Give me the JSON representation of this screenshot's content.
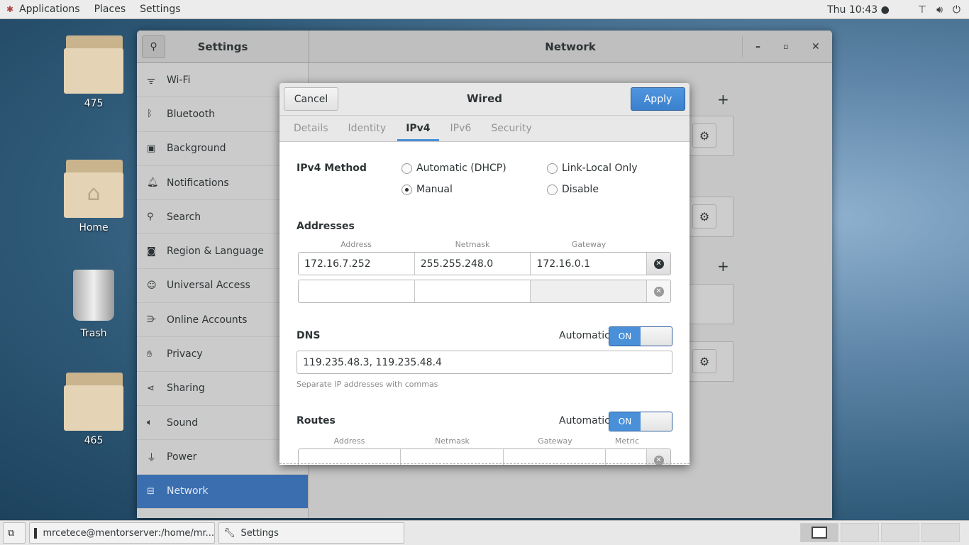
{
  "topbar": {
    "applications": "Applications",
    "places": "Places",
    "settings": "Settings",
    "clock": "Thu 10:43",
    "icons": [
      "network-icon",
      "volume-icon",
      "power-icon"
    ]
  },
  "desktop": [
    {
      "label": "475",
      "icon": "folder-icon"
    },
    {
      "label": "Home",
      "icon": "home-folder-icon"
    },
    {
      "label": "Trash",
      "icon": "trash-icon"
    },
    {
      "label": "465",
      "icon": "folder-icon"
    }
  ],
  "settings_window": {
    "sidebar_title": "Settings",
    "title": "Network",
    "sidebar": [
      {
        "label": "Wi-Fi",
        "icon": "wifi-icon"
      },
      {
        "label": "Bluetooth",
        "icon": "bluetooth-icon"
      },
      {
        "label": "Background",
        "icon": "background-icon"
      },
      {
        "label": "Notifications",
        "icon": "bell-icon"
      },
      {
        "label": "Search",
        "icon": "search-icon"
      },
      {
        "label": "Region & Language",
        "icon": "camera-icon"
      },
      {
        "label": "Universal Access",
        "icon": "accessibility-icon"
      },
      {
        "label": "Online Accounts",
        "icon": "online-accounts-icon"
      },
      {
        "label": "Privacy",
        "icon": "hand-icon"
      },
      {
        "label": "Sharing",
        "icon": "share-icon"
      },
      {
        "label": "Sound",
        "icon": "speaker-icon"
      },
      {
        "label": "Power",
        "icon": "power-plug-icon"
      },
      {
        "label": "Network",
        "icon": "network-icon",
        "selected": true
      }
    ]
  },
  "dialog": {
    "title": "Wired",
    "cancel": "Cancel",
    "apply": "Apply",
    "tabs": [
      "Details",
      "Identity",
      "IPv4",
      "IPv6",
      "Security"
    ],
    "active_tab": "IPv4",
    "method_label": "IPv4 Method",
    "methods": [
      {
        "label": "Automatic (DHCP)",
        "selected": false
      },
      {
        "label": "Link-Local Only",
        "selected": false
      },
      {
        "label": "Manual",
        "selected": true
      },
      {
        "label": "Disable",
        "selected": false
      }
    ],
    "addresses": {
      "label": "Addresses",
      "headers": [
        "Address",
        "Netmask",
        "Gateway"
      ],
      "rows": [
        [
          "172.16.7.252",
          "255.255.248.0",
          "172.16.0.1"
        ],
        [
          "",
          "",
          ""
        ]
      ]
    },
    "dns": {
      "label": "DNS",
      "auto_label": "Automatic",
      "switch": "ON",
      "value": "119.235.48.3, 119.235.48.4",
      "hint": "Separate IP addresses with commas"
    },
    "routes": {
      "label": "Routes",
      "auto_label": "Automatic",
      "switch": "ON",
      "headers": [
        "Address",
        "Netmask",
        "Gateway",
        "Metric"
      ]
    }
  },
  "taskbar": {
    "items": [
      "mrcetece@mentorserver:/home/mr...",
      "Settings"
    ]
  },
  "colors": {
    "accent": "#4a90d9",
    "selected": "#3b6eaf"
  }
}
